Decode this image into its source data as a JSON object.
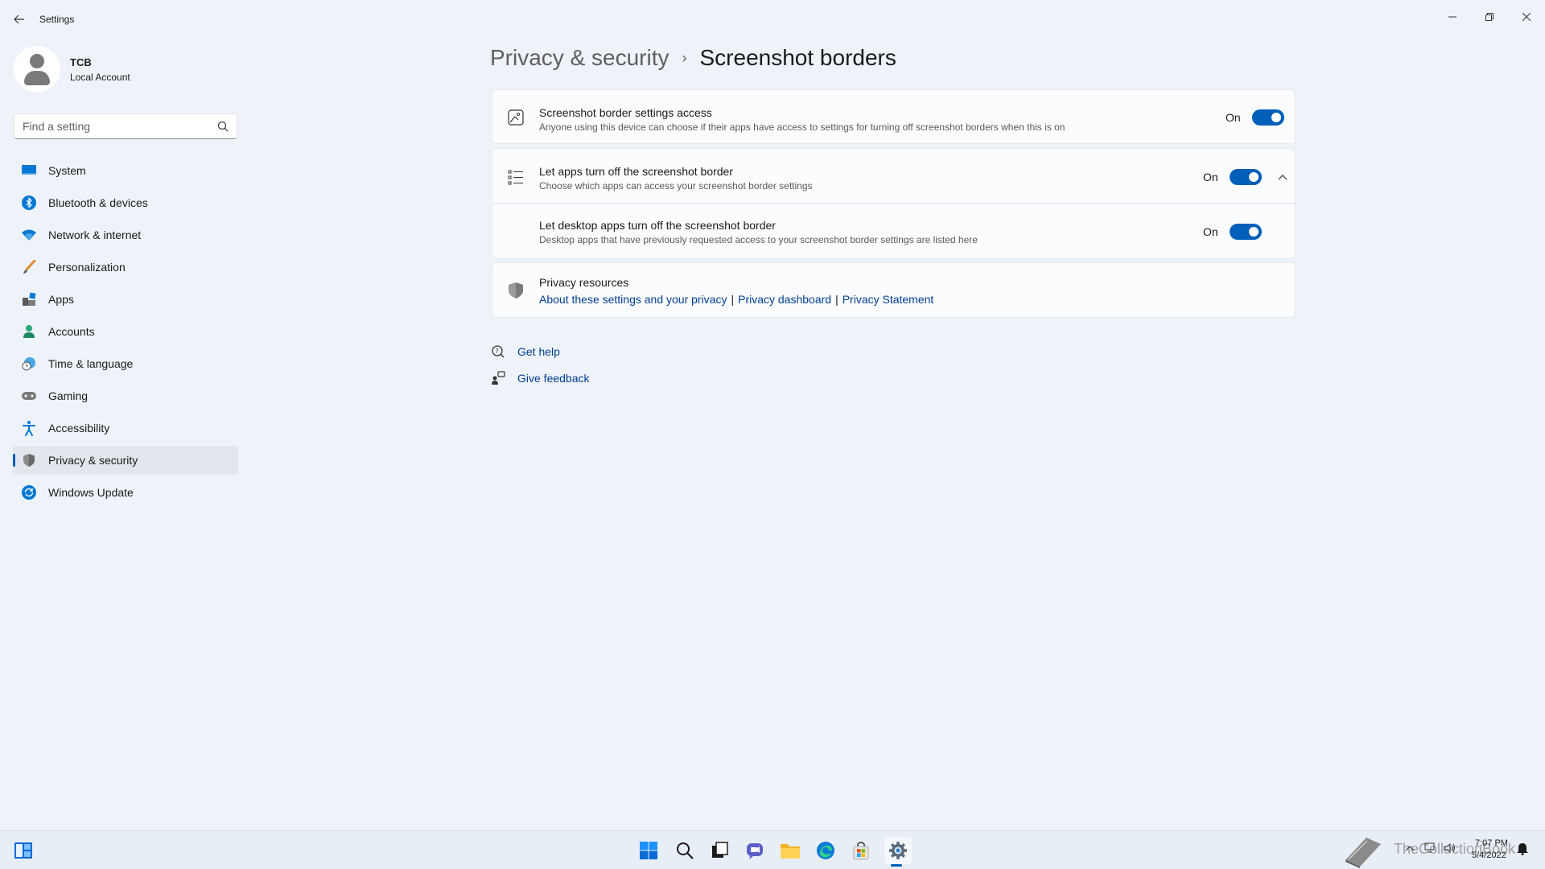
{
  "window": {
    "title": "Settings",
    "back_icon": "arrow-left-icon"
  },
  "profile": {
    "name": "TCB",
    "account_type": "Local Account"
  },
  "search": {
    "placeholder": "Find a setting"
  },
  "sidebar": {
    "items": [
      {
        "label": "System",
        "icon": "system-icon",
        "active": false
      },
      {
        "label": "Bluetooth & devices",
        "icon": "bluetooth-icon",
        "active": false
      },
      {
        "label": "Network & internet",
        "icon": "wifi-icon",
        "active": false
      },
      {
        "label": "Personalization",
        "icon": "brush-icon",
        "active": false
      },
      {
        "label": "Apps",
        "icon": "apps-icon",
        "active": false
      },
      {
        "label": "Accounts",
        "icon": "accounts-icon",
        "active": false
      },
      {
        "label": "Time & language",
        "icon": "clock-globe-icon",
        "active": false
      },
      {
        "label": "Gaming",
        "icon": "gamepad-icon",
        "active": false
      },
      {
        "label": "Accessibility",
        "icon": "accessibility-icon",
        "active": false
      },
      {
        "label": "Privacy & security",
        "icon": "shield-icon",
        "active": true
      },
      {
        "label": "Windows Update",
        "icon": "update-icon",
        "active": false
      }
    ]
  },
  "breadcrumb": {
    "parent": "Privacy & security",
    "separator": "›",
    "current": "Screenshot borders"
  },
  "settings": {
    "access": {
      "title": "Screenshot border settings access",
      "description": "Anyone using this device can choose if their apps have access to settings for turning off screenshot borders when this is on",
      "state": "On"
    },
    "apps": {
      "title": "Let apps turn off the screenshot border",
      "description": "Choose which apps can access your screenshot border settings",
      "state": "On"
    },
    "desktop_apps": {
      "title": "Let desktop apps turn off the screenshot border",
      "description": "Desktop apps that have previously requested access to your screenshot border settings are listed here",
      "state": "On"
    }
  },
  "privacy_resources": {
    "title": "Privacy resources",
    "links": [
      "About these settings and your privacy",
      "Privacy dashboard",
      "Privacy Statement"
    ],
    "separator": "|"
  },
  "help": {
    "get_help": "Get help",
    "give_feedback": "Give feedback"
  },
  "taskbar": {
    "time": "7:07 PM",
    "date": "5/4/2022",
    "watermark": "TheCollectionBook"
  },
  "colors": {
    "accent": "#005fb8",
    "link": "#003e92",
    "background": "#eef3f9"
  }
}
